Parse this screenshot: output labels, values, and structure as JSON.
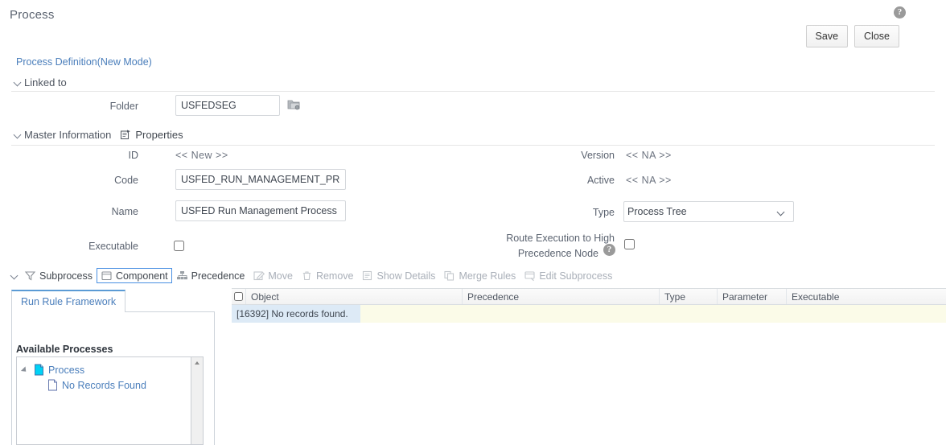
{
  "header": {
    "title": "Process",
    "help_icon": "help-circle-icon",
    "save_label": "Save",
    "close_label": "Close"
  },
  "breadcrumb": "Process Definition(New Mode)",
  "sections": {
    "linked_to": "Linked to",
    "master_information": "Master Information",
    "properties": "Properties"
  },
  "linked_to": {
    "folder_label": "Folder",
    "folder_value": "USFEDSEG",
    "folder_placeholder": "",
    "browse_icon": "folder-browse-icon"
  },
  "master": {
    "id_label": "ID",
    "id_value": "<< New >>",
    "code_label": "Code",
    "code_value": "USFED_RUN_MANAGEMENT_PROCESS",
    "name_label": "Name",
    "name_value": "USFED Run Management Process",
    "executable_label": "Executable",
    "executable_checked": false,
    "version_label": "Version",
    "version_value": "<< NA >>",
    "active_label": "Active",
    "active_value": "<< NA >>",
    "type_label": "Type",
    "type_value": "Process Tree",
    "type_options": [
      "Process Tree"
    ],
    "route_label_line1": "Route Execution to High",
    "route_label_line2": "Precedence Node",
    "route_help_icon": "help-circle-icon",
    "route_checked": false
  },
  "toolbar": [
    {
      "label": "Subprocess",
      "icon": "filter-funnel-icon",
      "disabled": false,
      "focused": false
    },
    {
      "label": "Component",
      "icon": "component-box-icon",
      "disabled": false,
      "focused": true
    },
    {
      "label": "Precedence",
      "icon": "hierarchy-icon",
      "disabled": false,
      "focused": false
    },
    {
      "label": "Move",
      "icon": "edit-pencil-icon",
      "disabled": true,
      "focused": false
    },
    {
      "label": "Remove",
      "icon": "trash-icon",
      "disabled": true,
      "focused": false
    },
    {
      "label": "Show Details",
      "icon": "document-list-icon",
      "disabled": true,
      "focused": false
    },
    {
      "label": "Merge Rules",
      "icon": "merge-icon",
      "disabled": true,
      "focused": false
    },
    {
      "label": "Edit Subprocess",
      "icon": "edit-subprocess-icon",
      "disabled": true,
      "focused": false
    }
  ],
  "left_panel": {
    "tab_label": "Run Rule Framework",
    "available_label": "Available Processes",
    "tree": [
      {
        "label": "Process",
        "level": 0,
        "icon": "document-cyan-icon",
        "expanded": true
      },
      {
        "label": "No Records Found",
        "level": 1,
        "icon": "document-blank-icon",
        "expanded": false
      }
    ]
  },
  "grid": {
    "columns": [
      "Object",
      "Precedence",
      "Type",
      "Parameter",
      "Executable"
    ],
    "message": "[16392] No records found."
  },
  "colors": {
    "link": "#4a7ebb",
    "accent": "#5b9bd5",
    "focus": "#4a90e2",
    "row_bg": "#fbfbe8",
    "msg_bg": "#ddeaf6"
  }
}
